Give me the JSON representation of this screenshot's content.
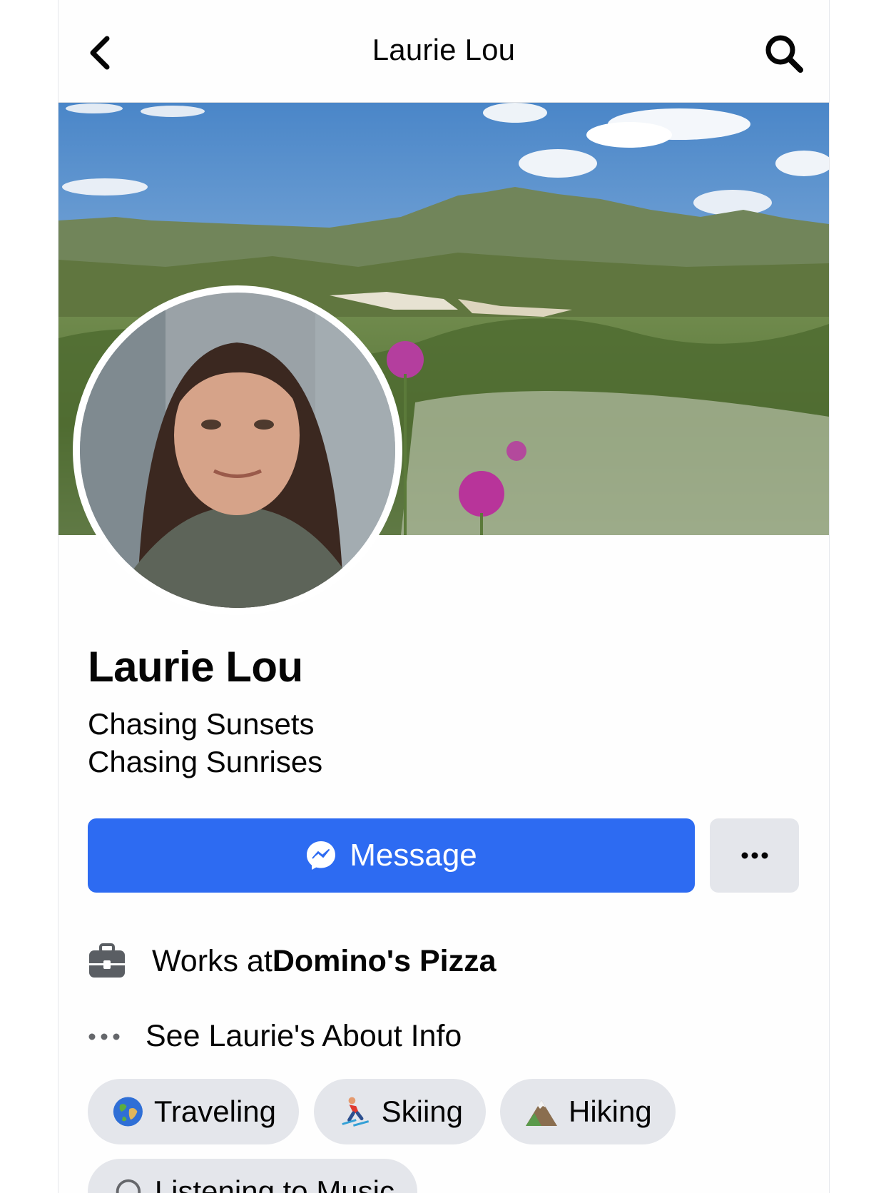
{
  "header": {
    "title": "Laurie Lou"
  },
  "profile": {
    "name": "Laurie Lou",
    "bio_line1": "Chasing Sunsets",
    "bio_line2": "Chasing Sunrises"
  },
  "actions": {
    "message_label": "Message",
    "more_label": "•••"
  },
  "intro": {
    "work_prefix": "Works at ",
    "work_place": "Domino's Pizza",
    "about_label": "See Laurie's About Info"
  },
  "interests": [
    {
      "label": "Traveling",
      "icon": "globe-icon"
    },
    {
      "label": "Skiing",
      "icon": "skier-icon"
    },
    {
      "label": "Hiking",
      "icon": "mountain-icon"
    },
    {
      "label": "Listening to Music",
      "icon": "headphones-icon"
    }
  ],
  "colors": {
    "accent": "#2d6bf2",
    "chip_bg": "#e4e6eb",
    "text": "#050505"
  }
}
